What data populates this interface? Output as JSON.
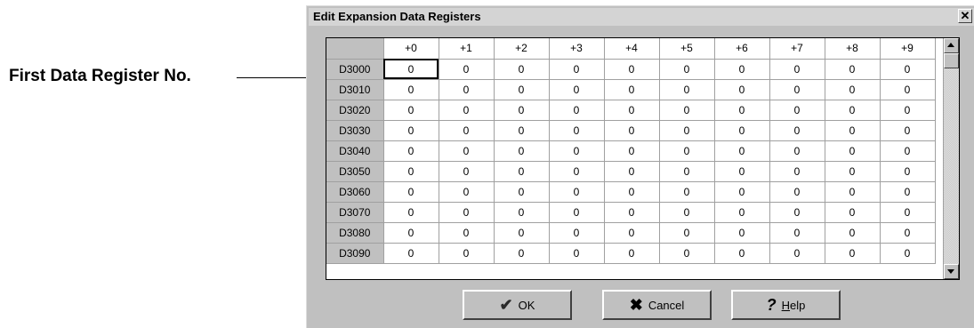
{
  "callout": {
    "label": "First Data Register No."
  },
  "dialog": {
    "title": "Edit Expansion Data Registers",
    "close_glyph": "✕",
    "columns": [
      "+0",
      "+1",
      "+2",
      "+3",
      "+4",
      "+5",
      "+6",
      "+7",
      "+8",
      "+9"
    ],
    "rows": [
      {
        "label": "D3000",
        "values": [
          "0",
          "0",
          "0",
          "0",
          "0",
          "0",
          "0",
          "0",
          "0",
          "0"
        ]
      },
      {
        "label": "D3010",
        "values": [
          "0",
          "0",
          "0",
          "0",
          "0",
          "0",
          "0",
          "0",
          "0",
          "0"
        ]
      },
      {
        "label": "D3020",
        "values": [
          "0",
          "0",
          "0",
          "0",
          "0",
          "0",
          "0",
          "0",
          "0",
          "0"
        ]
      },
      {
        "label": "D3030",
        "values": [
          "0",
          "0",
          "0",
          "0",
          "0",
          "0",
          "0",
          "0",
          "0",
          "0"
        ]
      },
      {
        "label": "D3040",
        "values": [
          "0",
          "0",
          "0",
          "0",
          "0",
          "0",
          "0",
          "0",
          "0",
          "0"
        ]
      },
      {
        "label": "D3050",
        "values": [
          "0",
          "0",
          "0",
          "0",
          "0",
          "0",
          "0",
          "0",
          "0",
          "0"
        ]
      },
      {
        "label": "D3060",
        "values": [
          "0",
          "0",
          "0",
          "0",
          "0",
          "0",
          "0",
          "0",
          "0",
          "0"
        ]
      },
      {
        "label": "D3070",
        "values": [
          "0",
          "0",
          "0",
          "0",
          "0",
          "0",
          "0",
          "0",
          "0",
          "0"
        ]
      },
      {
        "label": "D3080",
        "values": [
          "0",
          "0",
          "0",
          "0",
          "0",
          "0",
          "0",
          "0",
          "0",
          "0"
        ]
      },
      {
        "label": "D3090",
        "values": [
          "0",
          "0",
          "0",
          "0",
          "0",
          "0",
          "0",
          "0",
          "0",
          "0"
        ]
      }
    ],
    "selected_cell": {
      "row": 0,
      "col": 0
    }
  },
  "buttons": {
    "ok": {
      "icon": "checkmark-icon",
      "label": "OK"
    },
    "cancel": {
      "icon": "x-icon",
      "label": "Cancel"
    },
    "help": {
      "icon": "question-icon",
      "label_first": "H",
      "label_rest": "elp"
    }
  }
}
